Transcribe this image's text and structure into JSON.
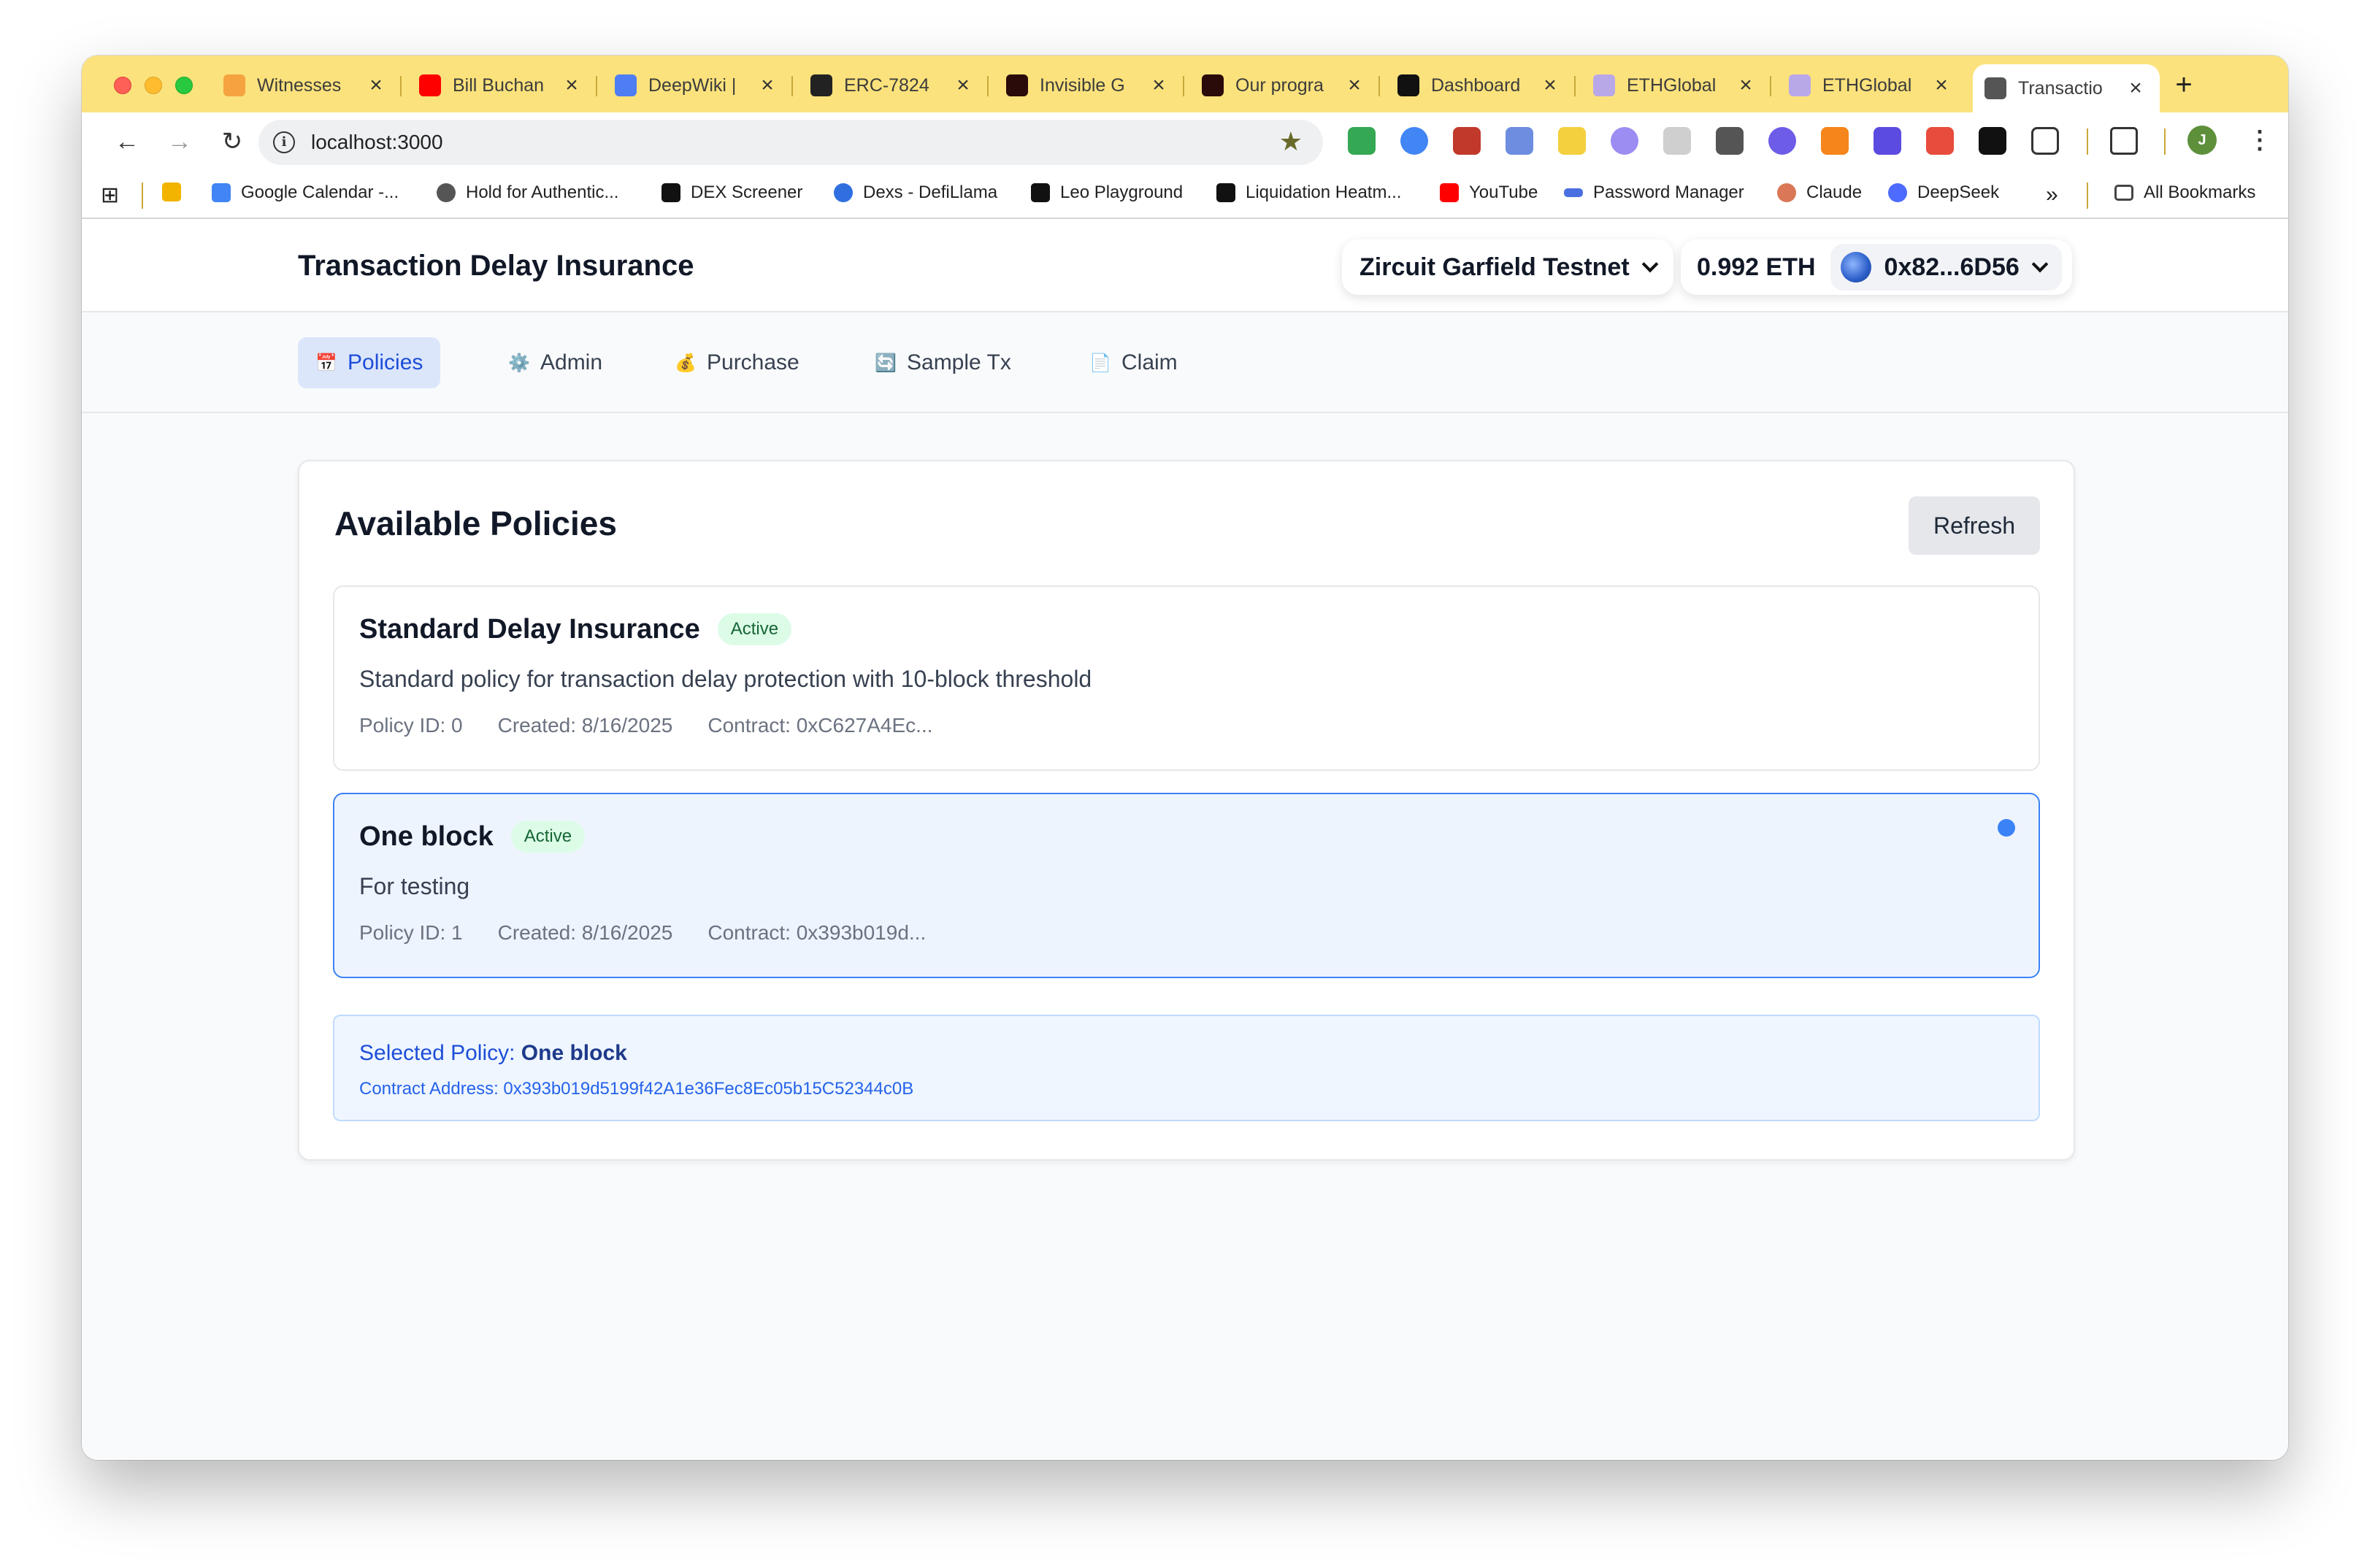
{
  "browser": {
    "tabs": [
      {
        "title": "Witnesses",
        "color": "#f4a340"
      },
      {
        "title": "Bill Buchan",
        "color": "#ff0000"
      },
      {
        "title": "DeepWiki |",
        "color": "#4f7df3"
      },
      {
        "title": "ERC-7824",
        "color": "#222222"
      },
      {
        "title": "Invisible G",
        "color": "#2b0a0a"
      },
      {
        "title": "Our progra",
        "color": "#2b0a0a"
      },
      {
        "title": "Dashboard",
        "color": "#111111"
      },
      {
        "title": "ETHGlobal",
        "color": "#b9a8e8"
      },
      {
        "title": "ETHGlobal",
        "color": "#b9a8e8"
      },
      {
        "title": "Transactio",
        "color": "#555555"
      }
    ],
    "new_tab": "+",
    "url": "localhost:3000",
    "bookmarks": [
      {
        "label": "",
        "color": "#f2b400"
      },
      {
        "label": "Google Calendar -...",
        "color": "#4285f4"
      },
      {
        "label": "Hold for Authentic...",
        "color": "#555555"
      },
      {
        "label": "DEX Screener",
        "color": "#111111"
      },
      {
        "label": "Dexs - DefiLlama",
        "color": "#2f6fe0"
      },
      {
        "label": "Leo Playground",
        "color": "#111111"
      },
      {
        "label": "Liquidation Heatm...",
        "color": "#111111"
      },
      {
        "label": "YouTube",
        "color": "#ff0000"
      },
      {
        "label": "Password Manager",
        "color": "#4a6fe0"
      },
      {
        "label": "Claude",
        "color": "#d97757"
      },
      {
        "label": "DeepSeek",
        "color": "#4d6bfe"
      }
    ],
    "bookmarks_overflow": "»",
    "all_bookmarks": "All Bookmarks",
    "profile_initial": "J"
  },
  "app": {
    "title": "Transaction Delay Insurance",
    "network": "Zircuit Garfield Testnet",
    "balance": "0.992 ETH",
    "address": "0x82...6D56",
    "nav": [
      {
        "label": "Policies",
        "icon": "📅",
        "active": true
      },
      {
        "label": "Admin",
        "icon": "⚙️"
      },
      {
        "label": "Purchase",
        "icon": "💰"
      },
      {
        "label": "Sample Tx",
        "icon": "🔄"
      },
      {
        "label": "Claim",
        "icon": "📄"
      }
    ]
  },
  "policies_panel": {
    "title": "Available Policies",
    "refresh_label": "Refresh",
    "policies": [
      {
        "name": "Standard Delay Insurance",
        "status": "Active",
        "description": "Standard policy for transaction delay protection with 10-block threshold",
        "policy_id": "Policy ID: 0",
        "created": "Created: 8/16/2025",
        "contract": "Contract: 0xC627A4Ec..."
      },
      {
        "name": "One block",
        "status": "Active",
        "description": "For testing",
        "policy_id": "Policy ID: 1",
        "created": "Created: 8/16/2025",
        "contract": "Contract: 0x393b019d..."
      }
    ],
    "selected": {
      "prefix": "Selected Policy: ",
      "name": "One block",
      "address": "Contract Address: 0x393b019d5199f42A1e36Fec8Ec05b15C52344c0B"
    }
  }
}
